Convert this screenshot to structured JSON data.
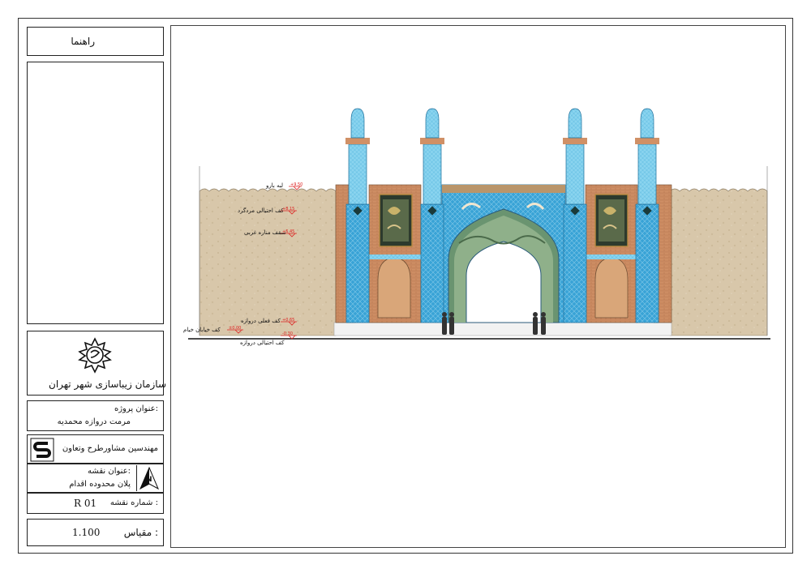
{
  "title_block": {
    "guide_label": "راهنما",
    "organization": "سازمان زیباسازی شهر تهران",
    "project_label": "عنوان پروژه:",
    "project_name": "مرمت دروازه محمدیه",
    "consultant": "مهندسین مشاورطرح وتعاون",
    "map_title_label": "عنوان نقشه:",
    "map_title": "پلان محدوده اقدام",
    "north_label": "N",
    "sheet_number_label": "شماره نقشه :",
    "sheet_number": "R 01",
    "scale_label": "مقیاس :",
    "scale_value": "1.100"
  },
  "drawing": {
    "labels": [
      "لبه بارو",
      "کف احتیالی مردگرد",
      "سقف مناره غربی",
      "کف فعلی دروازه",
      "کف خیابان خیام",
      "کف احتیالی دروازه"
    ],
    "levels": [
      "+9.50",
      "+8.15",
      "+6.45",
      "+0.65",
      "±0.00",
      "-0.30"
    ]
  },
  "colors": {
    "tile_blue": "#3aa6d8",
    "light_blue": "#8fd4ef",
    "brick": "#c98a60",
    "wall": "#d8c6a8",
    "dark_panel": "#2a3a2a"
  }
}
